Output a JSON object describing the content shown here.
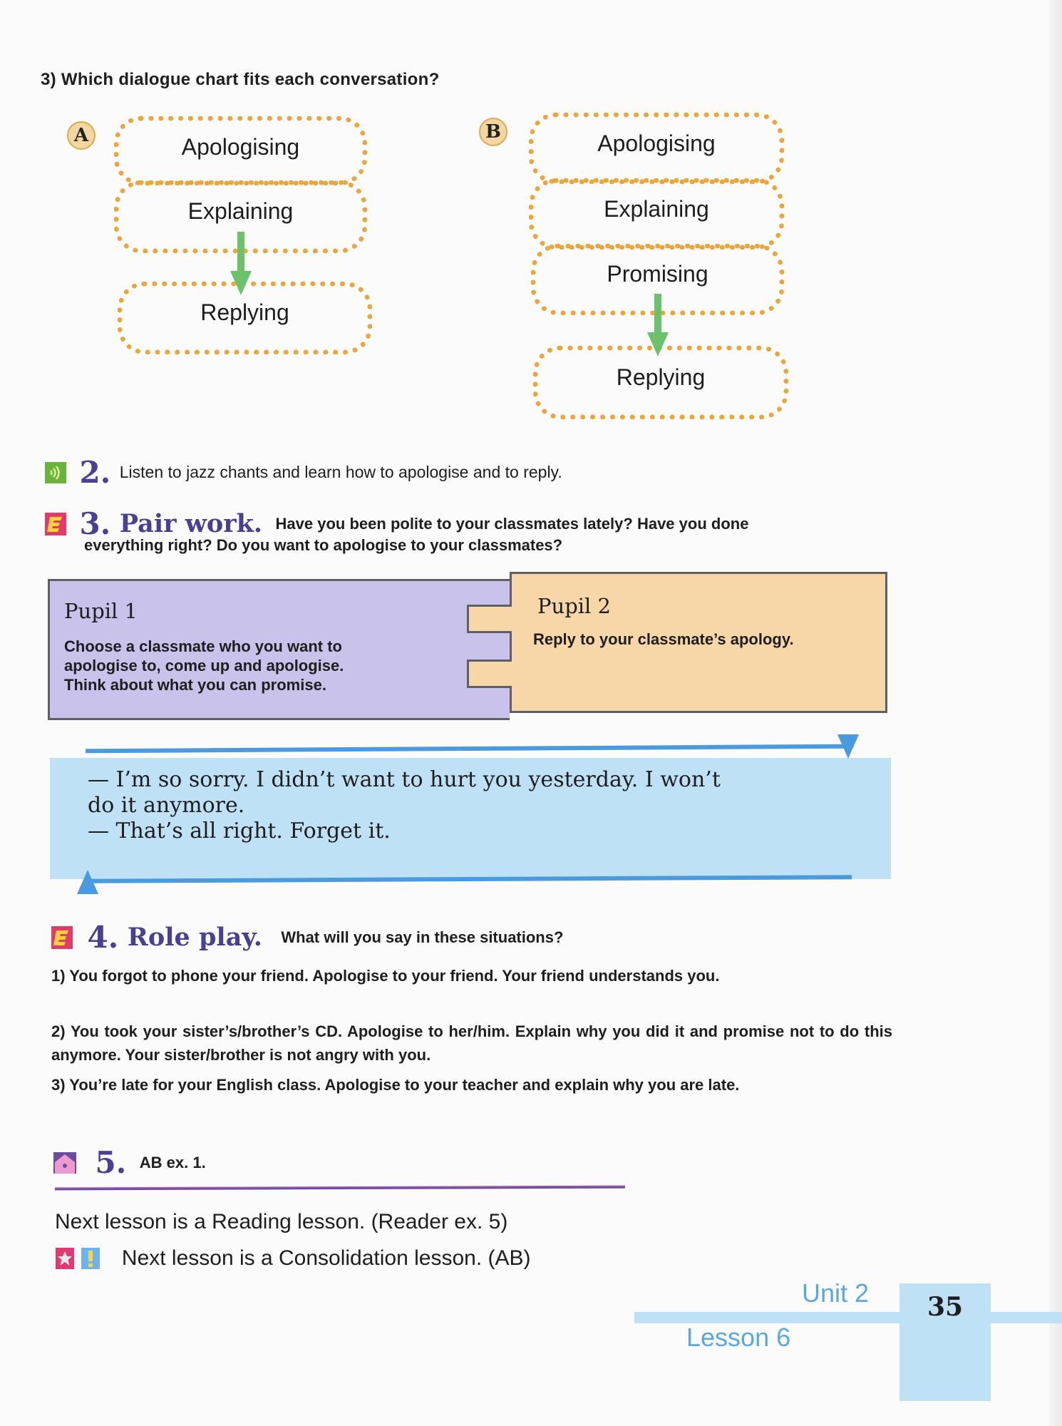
{
  "question3": {
    "label": "3) Which dialogue chart fits each conversation?"
  },
  "chartA": {
    "badge": "A",
    "steps": [
      "Apologising",
      "Explaining",
      "Replying"
    ]
  },
  "chartB": {
    "badge": "B",
    "steps": [
      "Apologising",
      "Explaining",
      "Promising",
      "Replying"
    ]
  },
  "exercise2": {
    "number": "2.",
    "icon": "audio-listen-icon",
    "text": "Listen to jazz chants and learn how to apologise and to reply."
  },
  "exercise3": {
    "number": "3.",
    "icon": "speaking-e-icon",
    "title": "Pair work.",
    "text_line1": "Have you been polite to your classmates lately? Have you done",
    "text_line2": "everything right? Do you want to apologise to your classmates?",
    "pupil1": {
      "title": "Pupil 1",
      "lines": [
        "Choose a classmate who you want to",
        "apologise to, come up and apologise.",
        "Think about what you can promise."
      ]
    },
    "pupil2": {
      "title": "Pupil 2",
      "text": "Reply to your classmate’s apology."
    }
  },
  "dialogue": {
    "line1a": "— I’m so sorry. I didn’t want to hurt you yesterday. I won’t",
    "line1b": "do it anymore.",
    "line2": "— That’s all right. Forget it."
  },
  "exercise4": {
    "number": "4.",
    "icon": "speaking-e-icon",
    "title": "Role play.",
    "text": "What will you say in these situations?",
    "items": [
      "1) You forgot to phone your friend. Apologise to your friend. Your friend understands you.",
      "2) You took your sister’s/brother’s CD. Apologise to her/him. Explain why you did it and promise not to do this anymore. Your sister/brother is not angry with you.",
      "3) You’re late for your English class. Apologise to your teacher and explain why you are late."
    ]
  },
  "exercise5": {
    "number": "5.",
    "icon": "home-icon",
    "text": "AB ex. 1."
  },
  "next": {
    "reading": "Next lesson is a Reading lesson. (Reader ex. 5)",
    "consolidation": "Next lesson is a Consolidation lesson. (AB)"
  },
  "footer": {
    "unit": "Unit 2",
    "lesson": "Lesson 6",
    "page": "35"
  },
  "colors": {
    "dots": "#eda53a",
    "arrow": "#6cc26a",
    "exercise_number": "#4a3f96",
    "pupil1_bg": "#c9c2ea",
    "pupil2_bg": "#f7d7a8",
    "dialogue_bg": "#bfe1f6",
    "footer_text": "#5aa8e0"
  }
}
